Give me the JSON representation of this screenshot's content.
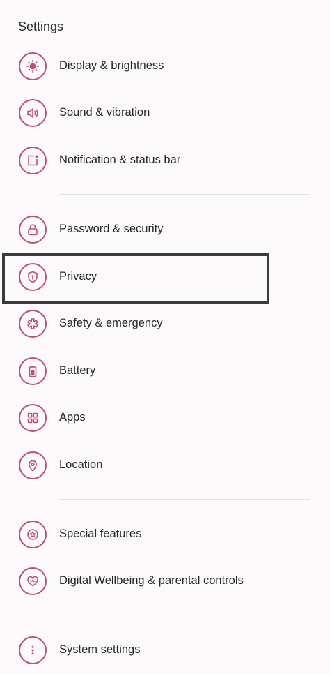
{
  "header": {
    "title": "Settings"
  },
  "items": [
    {
      "id": "display",
      "label": "Display & brightness",
      "icon": "sun-icon"
    },
    {
      "id": "sound",
      "label": "Sound & vibration",
      "icon": "speaker-icon"
    },
    {
      "id": "notification",
      "label": "Notification & status bar",
      "icon": "notification-icon"
    },
    {
      "id": "password",
      "label": "Password & security",
      "icon": "lock-icon"
    },
    {
      "id": "privacy",
      "label": "Privacy",
      "icon": "shield-icon"
    },
    {
      "id": "safety",
      "label": "Safety & emergency",
      "icon": "asterisk-icon"
    },
    {
      "id": "battery",
      "label": "Battery",
      "icon": "battery-icon"
    },
    {
      "id": "apps",
      "label": "Apps",
      "icon": "apps-grid-icon"
    },
    {
      "id": "location",
      "label": "Location",
      "icon": "location-pin-icon"
    },
    {
      "id": "special",
      "label": "Special features",
      "icon": "star-icon"
    },
    {
      "id": "wellbeing",
      "label": "Digital Wellbeing & parental controls",
      "icon": "heart-icon"
    },
    {
      "id": "system",
      "label": "System settings",
      "icon": "more-vertical-icon"
    }
  ],
  "colors": {
    "accent": "#c0506f",
    "background": "#fbf9fa",
    "highlight_border": "#3b3b3b"
  }
}
